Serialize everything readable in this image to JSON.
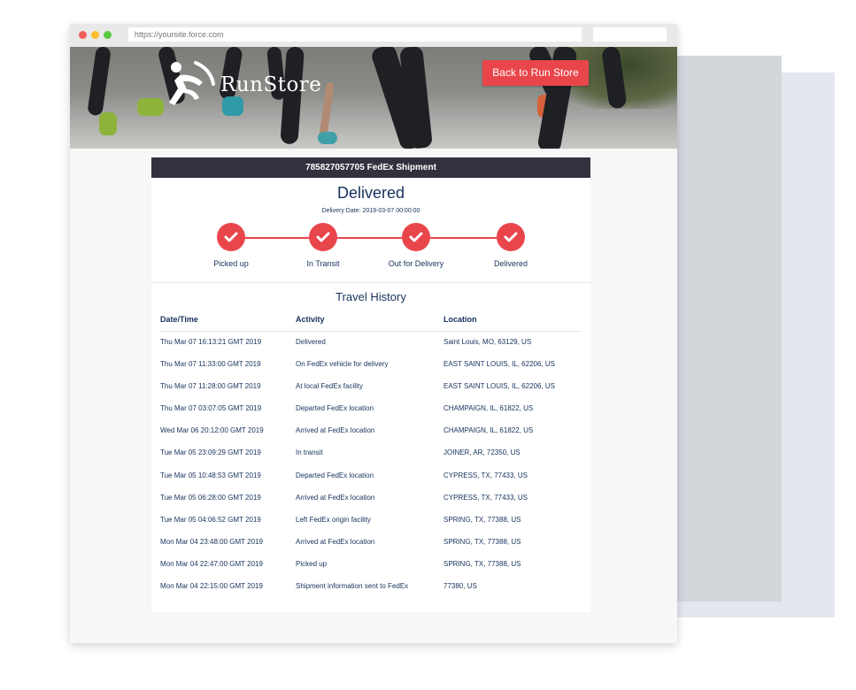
{
  "browser": {
    "url": "https://yoursite.force.com"
  },
  "header": {
    "logo_text": "RunStore",
    "back_button": "Back to Run Store"
  },
  "shipment": {
    "header": "785827057705 FedEx Shipment",
    "status": "Delivered",
    "delivery_date": "Delivery Date: 2019-03-07 00:00:00"
  },
  "steps": [
    {
      "label": "Picked up"
    },
    {
      "label": "In Transit"
    },
    {
      "label": "Out for Delivery"
    },
    {
      "label": "Delivered"
    }
  ],
  "colors": {
    "accent": "#e9464c",
    "header_bar": "#32323f",
    "text": "#16325c"
  },
  "history": {
    "title": "Travel History",
    "columns": [
      "Date/Time",
      "Activity",
      "Location"
    ],
    "rows": [
      {
        "datetime": "Thu Mar 07 16:13:21 GMT 2019",
        "activity": "Delivered",
        "location": "Saint Louis, MO, 63129, US"
      },
      {
        "datetime": "Thu Mar 07 11:33:00 GMT 2019",
        "activity": "On FedEx vehicle for delivery",
        "location": "EAST SAINT LOUIS, IL, 62206, US"
      },
      {
        "datetime": "Thu Mar 07 11:28:00 GMT 2019",
        "activity": "At local FedEx facility",
        "location": "EAST SAINT LOUIS, IL, 62206, US"
      },
      {
        "datetime": "Thu Mar 07 03:07:05 GMT 2019",
        "activity": "Departed FedEx location",
        "location": "CHAMPAIGN, IL, 61822, US"
      },
      {
        "datetime": "Wed Mar 06 20:12:00 GMT 2019",
        "activity": "Arrived at FedEx location",
        "location": "CHAMPAIGN, IL, 61822, US"
      },
      {
        "datetime": "Tue Mar 05 23:09:29 GMT 2019",
        "activity": "In transit",
        "location": "JOINER, AR, 72350, US"
      },
      {
        "datetime": "Tue Mar 05 10:48:53 GMT 2019",
        "activity": "Departed FedEx location",
        "location": "CYPRESS, TX, 77433, US"
      },
      {
        "datetime": "Tue Mar 05 06:28:00 GMT 2019",
        "activity": "Arrived at FedEx location",
        "location": "CYPRESS, TX, 77433, US"
      },
      {
        "datetime": "Tue Mar 05 04:06:52 GMT 2019",
        "activity": "Left FedEx origin facility",
        "location": "SPRING, TX, 77388, US"
      },
      {
        "datetime": "Mon Mar 04 23:48:00 GMT 2019",
        "activity": "Arrived at FedEx location",
        "location": "SPRING, TX, 77388, US"
      },
      {
        "datetime": "Mon Mar 04 22:47:00 GMT 2019",
        "activity": "Picked up",
        "location": "SPRING, TX, 77388, US"
      },
      {
        "datetime": "Mon Mar 04 22:15:00 GMT 2019",
        "activity": "Shipment information sent to FedEx",
        "location": "77380, US"
      }
    ]
  }
}
